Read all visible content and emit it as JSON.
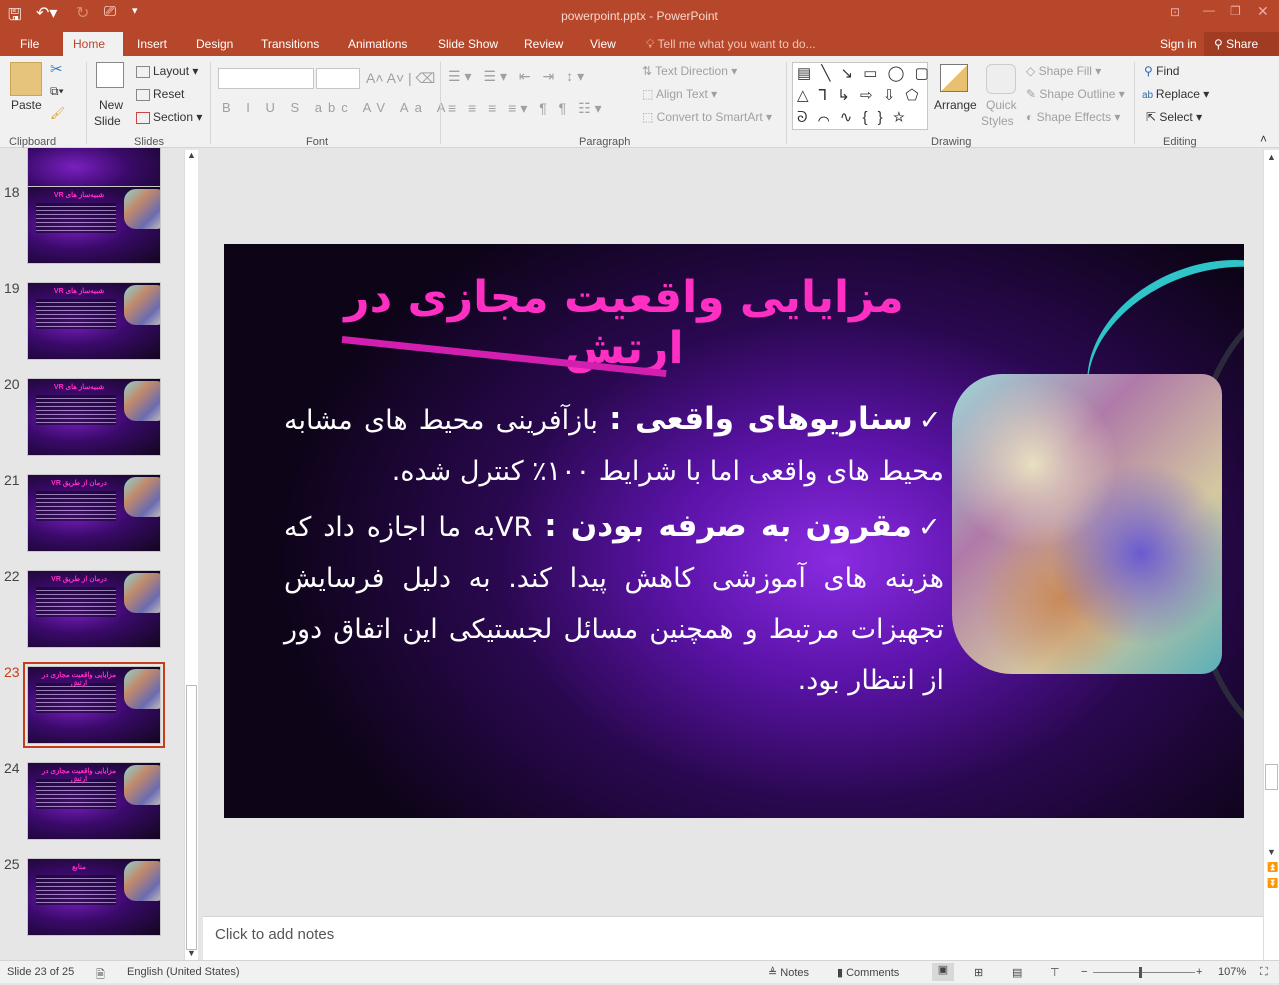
{
  "window": {
    "title": "powerpoint.pptx - PowerPoint",
    "controls": [
      "ribbon-display-options",
      "minimize",
      "restore",
      "close"
    ]
  },
  "qat": {
    "items": [
      "save",
      "undo",
      "redo",
      "start-from-beginning",
      "customize"
    ]
  },
  "tabs": [
    "File",
    "Home",
    "Insert",
    "Design",
    "Transitions",
    "Animations",
    "Slide Show",
    "Review",
    "View"
  ],
  "active_tab": "Home",
  "tell_me": "Tell me what you want to do...",
  "account": {
    "sign_in": "Sign in",
    "share": "Share"
  },
  "ribbon": {
    "clipboard": {
      "label": "Clipboard",
      "paste": "Paste"
    },
    "slides": {
      "label": "Slides",
      "new_slide_1": "New",
      "new_slide_2": "Slide",
      "layout": "Layout",
      "reset": "Reset",
      "section": "Section"
    },
    "font": {
      "label": "Font",
      "font_name": "",
      "font_size": ""
    },
    "paragraph": {
      "label": "Paragraph",
      "text_direction": "Text Direction",
      "align_text": "Align Text",
      "convert_smartart": "Convert to SmartArt"
    },
    "drawing": {
      "label": "Drawing",
      "arrange": "Arrange",
      "quick_styles_1": "Quick",
      "quick_styles_2": "Styles",
      "shape_fill": "Shape Fill",
      "shape_outline": "Shape Outline",
      "shape_effects": "Shape Effects"
    },
    "editing": {
      "label": "Editing",
      "find": "Find",
      "replace": "Replace",
      "select": "Select"
    }
  },
  "thumbnails": [
    {
      "num": "18",
      "title": "شبیه‌ساز های VR"
    },
    {
      "num": "19",
      "title": "شبیه‌ساز های VR"
    },
    {
      "num": "20",
      "title": "شبیه‌ساز های VR"
    },
    {
      "num": "21",
      "title": "درمان از طریق VR"
    },
    {
      "num": "22",
      "title": "درمان از طریق VR"
    },
    {
      "num": "23",
      "title": "مزایایی واقعیت مجازی در ارتش",
      "selected": true
    },
    {
      "num": "24",
      "title": "مزایایی واقعیت مجازی در ارتش"
    },
    {
      "num": "25",
      "title": "منابع"
    }
  ],
  "slide": {
    "title": "مزایایی واقعیت مجازی در ارتش",
    "bullets": [
      {
        "bold": "سناریوهای واقعی :",
        "text": " بازآفرینی محیط های مشابه محیط های واقعی اما با شرایط ۱۰۰٪ کنترل شده."
      },
      {
        "bold": "مقرون به صرفه بودن :",
        "text": " VRبه ما اجازه داد که هزینه های آموزشی کاهش پیدا کند. به دلیل فرسایش تجهیزات مرتبط و همچنین مسائل لجستیکی این اتفاق دور از انتظار بود."
      }
    ],
    "colors": {
      "title": "#ff2fc4",
      "background": "#2a0850"
    }
  },
  "notes": {
    "placeholder": "Click to add notes"
  },
  "status": {
    "slide": "Slide 23 of 25",
    "language": "English (United States)",
    "notes": "Notes",
    "comments": "Comments",
    "zoom": "107%",
    "zoom_fraction": 0.45
  }
}
